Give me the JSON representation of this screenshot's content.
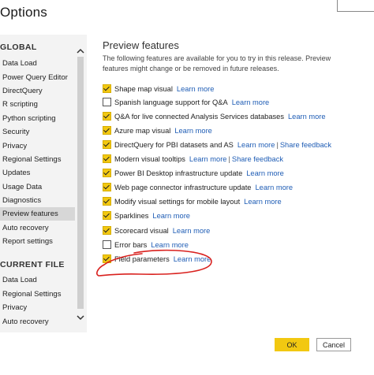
{
  "window": {
    "title": "Options"
  },
  "sidebar": {
    "sections": [
      {
        "header": "GLOBAL",
        "items": [
          {
            "label": "Data Load"
          },
          {
            "label": "Power Query Editor"
          },
          {
            "label": "DirectQuery"
          },
          {
            "label": "R scripting"
          },
          {
            "label": "Python scripting"
          },
          {
            "label": "Security"
          },
          {
            "label": "Privacy"
          },
          {
            "label": "Regional Settings"
          },
          {
            "label": "Updates"
          },
          {
            "label": "Usage Data"
          },
          {
            "label": "Diagnostics"
          },
          {
            "label": "Preview features",
            "selected": true
          },
          {
            "label": "Auto recovery"
          },
          {
            "label": "Report settings"
          }
        ]
      },
      {
        "header": "CURRENT FILE",
        "items": [
          {
            "label": "Data Load"
          },
          {
            "label": "Regional Settings"
          },
          {
            "label": "Privacy"
          },
          {
            "label": "Auto recovery"
          }
        ]
      }
    ],
    "scroll_up_icon": "chevron-up-icon",
    "scroll_down_icon": "chevron-down-icon"
  },
  "content": {
    "title": "Preview features",
    "description": "The following features are available for you to try in this release. Preview features might change or be removed in future releases.",
    "features": [
      {
        "label": "Shape map visual",
        "checked": true,
        "link": "Learn more"
      },
      {
        "label": "Spanish language support for Q&A",
        "checked": false,
        "link": "Learn more"
      },
      {
        "label": "Q&A for live connected Analysis Services databases",
        "checked": true,
        "link": "Learn more"
      },
      {
        "label": "Azure map visual",
        "checked": true,
        "link": "Learn more"
      },
      {
        "label": "DirectQuery for PBI datasets and AS",
        "checked": true,
        "link": "Learn more",
        "link2": "Share feedback"
      },
      {
        "label": "Modern visual tooltips",
        "checked": true,
        "link": "Learn more",
        "link2": "Share feedback"
      },
      {
        "label": "Power BI Desktop infrastructure update",
        "checked": true,
        "link": "Learn more"
      },
      {
        "label": "Web page connector infrastructure update",
        "checked": true,
        "link": "Learn more"
      },
      {
        "label": "Modify visual settings for mobile layout",
        "checked": true,
        "link": "Learn more"
      },
      {
        "label": "Sparklines",
        "checked": true,
        "link": "Learn more"
      },
      {
        "label": "Scorecard visual",
        "checked": true,
        "link": "Learn more"
      },
      {
        "label": "Error bars",
        "checked": false,
        "link": "Learn more"
      },
      {
        "label": "Field parameters",
        "checked": true,
        "link": "Learn more"
      }
    ],
    "separator": "|"
  },
  "buttons": {
    "ok": "OK",
    "cancel": "Cancel"
  },
  "colors": {
    "accent": "#f2c811",
    "link": "#1f5db5",
    "annotation": "#d9211e",
    "sidebar_bg": "#f3f3f3",
    "selected_bg": "#d7d7d7"
  }
}
